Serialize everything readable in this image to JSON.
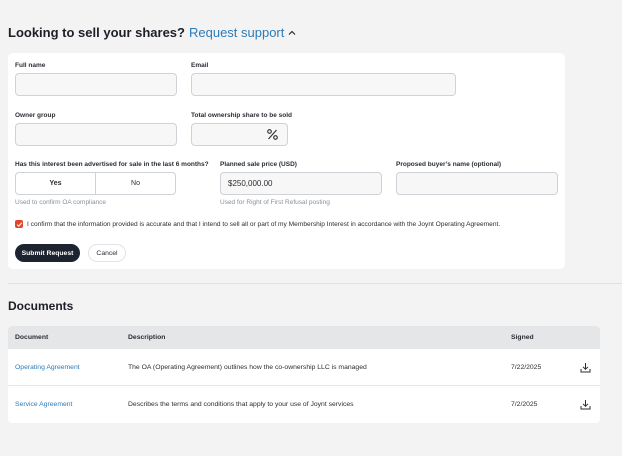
{
  "sell": {
    "heading": "Looking to sell your shares?",
    "link": "Request support"
  },
  "form": {
    "full_name": {
      "label": "Full name",
      "value": ""
    },
    "email": {
      "label": "Email",
      "value": ""
    },
    "owner_group": {
      "label": "Owner group",
      "value": ""
    },
    "ownership_share": {
      "label": "Total ownership share to be sold",
      "value": ""
    },
    "advertised": {
      "label": "Has this interest been advertised for sale in the last 6 months?",
      "options": [
        "Yes",
        "No"
      ],
      "selected": "Yes",
      "helper": "Used to confirm OA compliance"
    },
    "sale_price": {
      "label": "Planned sale price (USD)",
      "value": "$250,000.00",
      "helper": "Used for Right of First Refusal posting"
    },
    "buyer_name": {
      "label": "Proposed buyer’s name (optional)",
      "value": ""
    },
    "confirm_text": "I confirm that the information provided is accurate and that I intend to sell all or part of my Membership Interest in accordance with the Joynt Operating Agreement.",
    "confirm_checked": true,
    "submit_label": "Submit Request",
    "cancel_label": "Cancel"
  },
  "documents": {
    "title": "Documents",
    "columns": [
      "Document",
      "Description",
      "Signed"
    ],
    "rows": [
      {
        "document": "Operating Agreement",
        "description": "The OA (Operating Agreement) outlines how the co-ownership LLC is managed",
        "signed": "7/22/2025",
        "icon": "download-icon"
      },
      {
        "document": "Service Agreement",
        "description": "Describes the terms and conditions that apply to your use of Joynt services",
        "signed": "7/2/2025",
        "icon": "download-icon"
      }
    ]
  },
  "colors": {
    "accent_link": "#2b7bb9",
    "primary_button": "#1d2430",
    "checkbox": "#e2452c"
  }
}
